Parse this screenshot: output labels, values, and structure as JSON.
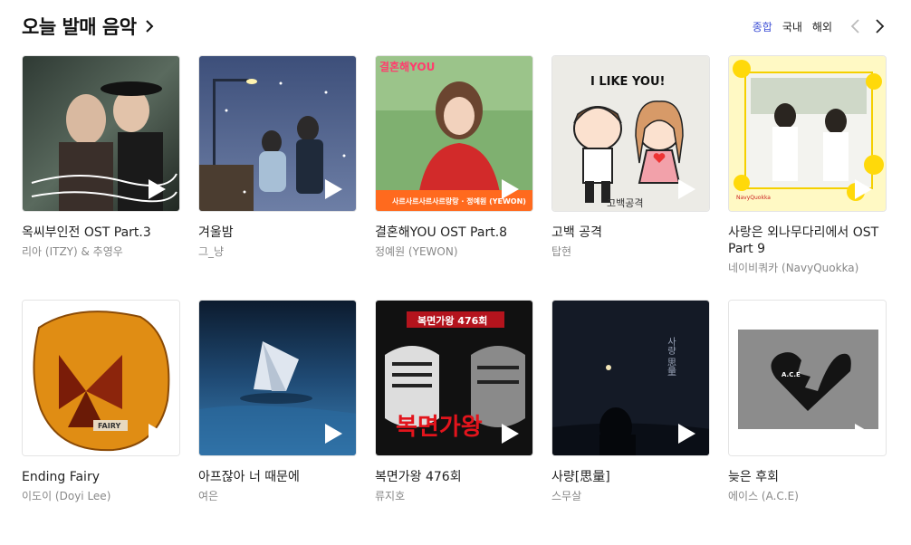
{
  "section": {
    "title": "오늘 발매 음악",
    "filters": [
      "종합",
      "국내",
      "해외"
    ],
    "active_filter": "종합",
    "accent": "#3f51d6"
  },
  "cover_texts": {
    "c3_top": "결혼해YOU",
    "c3_bottom": "사르사르사르사르랑랑 · 정예원 (YEWON)",
    "c4_top": "I LIKE YOU!",
    "c4_bottom": "고백공격",
    "c5_bottom": "NavyQuokka",
    "c6_badge": "FAIRY",
    "c8_top": "복면가왕 476회",
    "c8_mid": "복면가왕",
    "c9_vert": "사량 思量",
    "c10_heart": "A.C.E"
  },
  "albums": [
    {
      "title": "옥씨부인전 OST Part.3",
      "artist": "리아 (ITZY) & 추영우"
    },
    {
      "title": "겨울밤",
      "artist": "그_냥"
    },
    {
      "title": "결혼해YOU OST Part.8",
      "artist": "정예원 (YEWON)"
    },
    {
      "title": "고백 공격",
      "artist": "탑현"
    },
    {
      "title": "사랑은 외나무다리에서 OST Part 9",
      "artist": "네이비쿼카 (NavyQuokka)"
    },
    {
      "title": "Ending Fairy",
      "artist": "이도이 (Doyi Lee)"
    },
    {
      "title": "아프잖아 너 때문에",
      "artist": "여은"
    },
    {
      "title": "복면가왕 476회",
      "artist": "류지호"
    },
    {
      "title": "사량[思量]",
      "artist": "스무살"
    },
    {
      "title": "늦은 후회",
      "artist": "에이스 (A.C.E)"
    }
  ]
}
